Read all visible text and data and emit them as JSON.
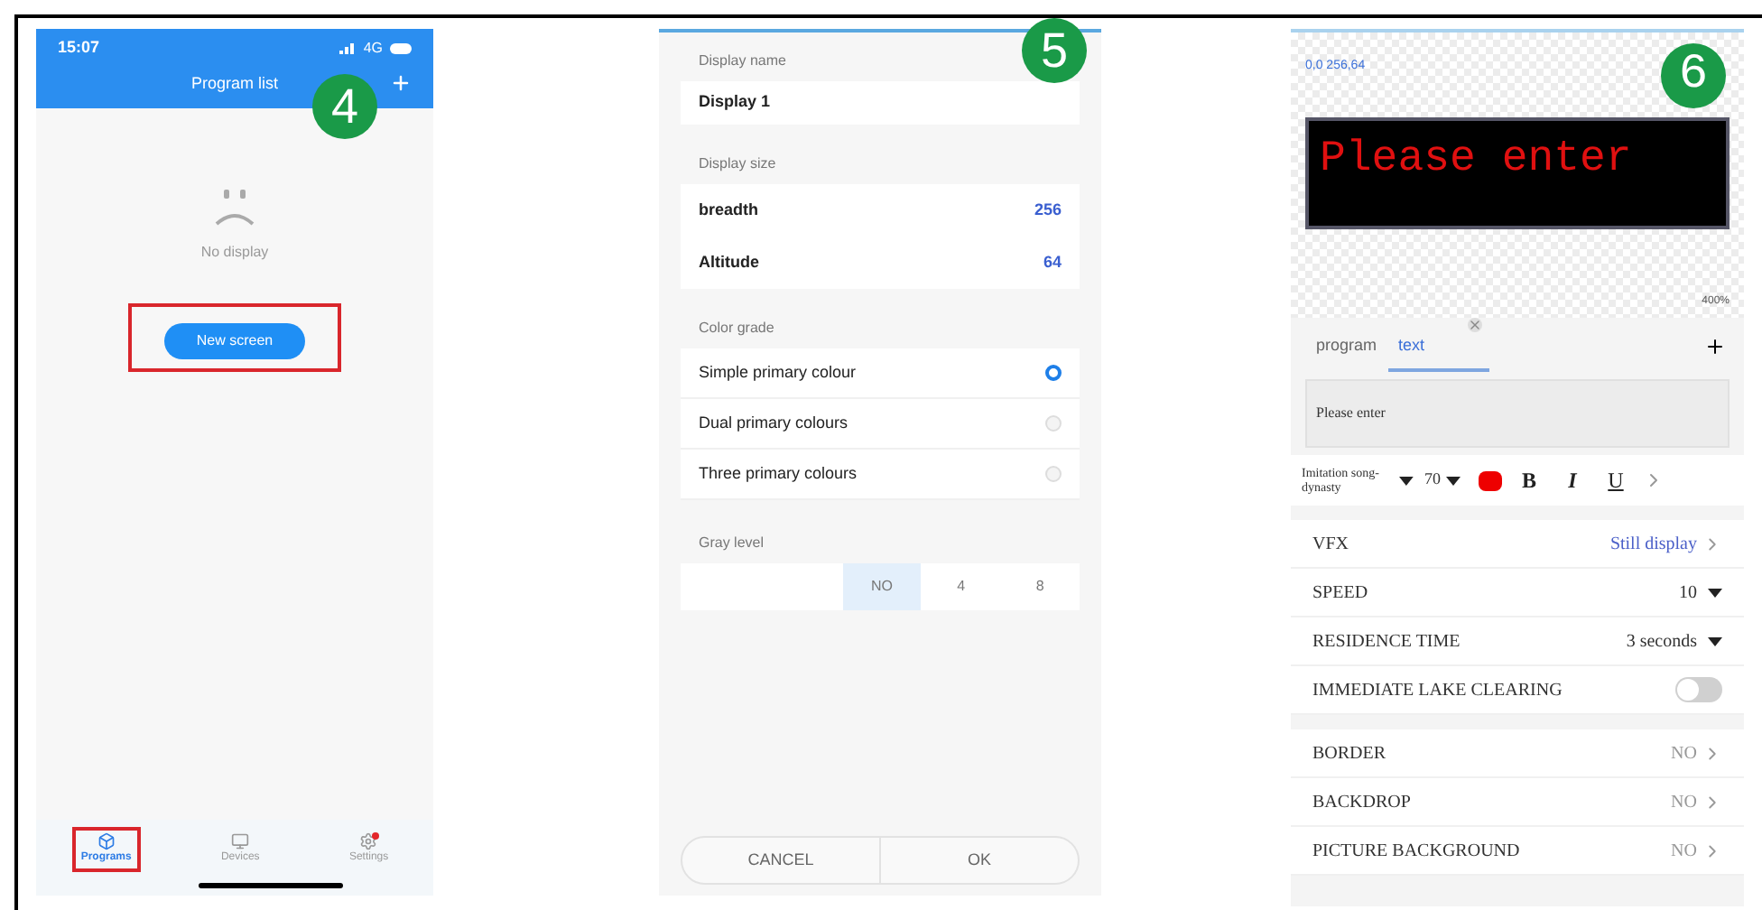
{
  "program_list": {
    "step": "4",
    "status_bar": {
      "time": "15:07",
      "network": "4G"
    },
    "title": "Program list",
    "empty_text": "No display",
    "new_screen_button": {
      "label": "New screen",
      "highlighted": true
    },
    "tabs": [
      {
        "label": "Programs",
        "selected": true,
        "highlighted": true,
        "badge": false
      },
      {
        "label": "Devices",
        "selected": false,
        "highlighted": false,
        "badge": false
      },
      {
        "label": "Settings",
        "selected": false,
        "highlighted": false,
        "badge": true
      }
    ]
  },
  "display_settings": {
    "step": "5",
    "name_label": "Display name",
    "name_value": "Display 1",
    "size_label": "Display size",
    "size_rows": [
      {
        "label": "breadth",
        "value": "256"
      },
      {
        "label": "Altitude",
        "value": "64"
      }
    ],
    "color_label": "Color grade",
    "color_options": [
      {
        "label": "Simple primary colour",
        "selected": true
      },
      {
        "label": "Dual primary colours",
        "selected": false
      },
      {
        "label": "Three primary colours",
        "selected": false
      }
    ],
    "gray_label": "Gray level",
    "gray_options": [
      {
        "label": "NO",
        "selected": true
      },
      {
        "label": "4",
        "selected": false
      },
      {
        "label": "8",
        "selected": false
      }
    ],
    "buttons": [
      "CANCEL",
      "OK"
    ]
  },
  "text_editor": {
    "step": "6",
    "coords": "0,0 256,64",
    "preview_text": "Please enter",
    "zoom": "400%",
    "tabs": [
      {
        "label": "program",
        "selected": false,
        "closable": false
      },
      {
        "label": "text",
        "selected": true,
        "closable": true
      }
    ],
    "text_value": "Please enter",
    "font": "Imitation song-dynasty",
    "font_size": "70",
    "style_buttons": [
      "B",
      "I",
      "U"
    ],
    "rows": [
      {
        "kind": "link",
        "label": "VFX",
        "value": "Still display",
        "accent": true
      },
      {
        "kind": "dropdown",
        "label": "SPEED",
        "value": "10"
      },
      {
        "kind": "dropdown",
        "label": "RESIDENCE TIME",
        "value": "3 seconds"
      },
      {
        "kind": "toggle",
        "label": "IMMEDIATE LAKE CLEARING",
        "on": false
      }
    ],
    "rows_2": [
      {
        "kind": "link",
        "label": "BORDER",
        "value": "NO",
        "accent": false
      },
      {
        "kind": "link",
        "label": "BACKDROP",
        "value": "NO",
        "accent": false
      },
      {
        "kind": "link",
        "label": "PICTURE BACKGROUND",
        "value": "NO",
        "accent": false
      }
    ]
  }
}
